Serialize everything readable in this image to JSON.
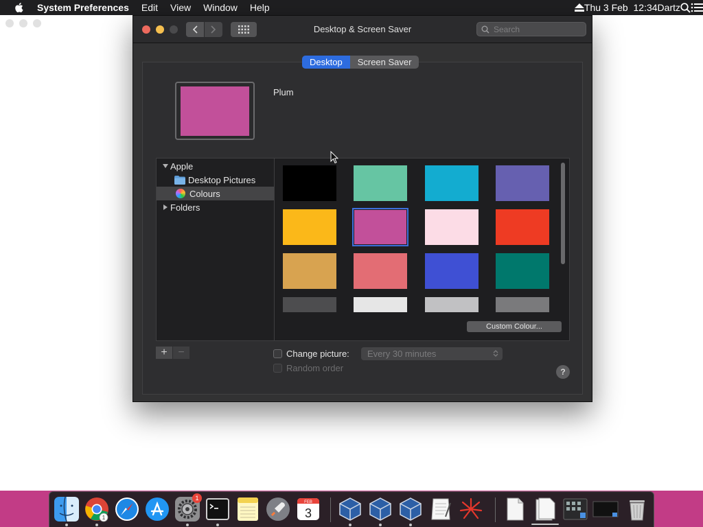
{
  "menubar": {
    "app_name": "System Preferences",
    "items": [
      "Edit",
      "View",
      "Window",
      "Help"
    ],
    "clock": "Thu 3 Feb  12:34",
    "user": "Dartz"
  },
  "window": {
    "title": "Desktop & Screen Saver",
    "search_placeholder": "Search",
    "tabs": [
      {
        "label": "Desktop",
        "active": true
      },
      {
        "label": "Screen Saver",
        "active": false
      }
    ],
    "current_wallpaper": {
      "name": "Plum",
      "color": "#c2509a"
    }
  },
  "sidebar": {
    "items": [
      {
        "label": "Apple",
        "type": "group",
        "expanded": true
      },
      {
        "label": "Desktop Pictures",
        "type": "folder"
      },
      {
        "label": "Colours",
        "type": "colours",
        "selected": true
      },
      {
        "label": "Folders",
        "type": "group",
        "expanded": false
      }
    ]
  },
  "colours": [
    [
      "#000000",
      "#66c5a3",
      "#13acd0",
      "#6660b0"
    ],
    [
      "#fbb819",
      "#c2509a",
      "#fcdce6",
      "#ee3b23"
    ],
    [
      "#d8a350",
      "#e36d74",
      "#3f50d4",
      "#00786c"
    ],
    [
      "#4d4d4f",
      "#e6e6e6",
      "#c1c1c3",
      "#7a7a7c"
    ]
  ],
  "selected_colour": {
    "row": 1,
    "col": 1
  },
  "controls": {
    "custom_colour_label": "Custom Colour...",
    "add_label": "+",
    "remove_label": "−",
    "change_picture_label": "Change picture:",
    "change_picture_checked": false,
    "interval_value": "Every 30 minutes",
    "random_order_label": "Random order",
    "help_label": "?"
  },
  "dock": {
    "calendar_month": "FEB",
    "calendar_day": "3",
    "sys_prefs_badge": "1",
    "chrome_badge": "1"
  }
}
